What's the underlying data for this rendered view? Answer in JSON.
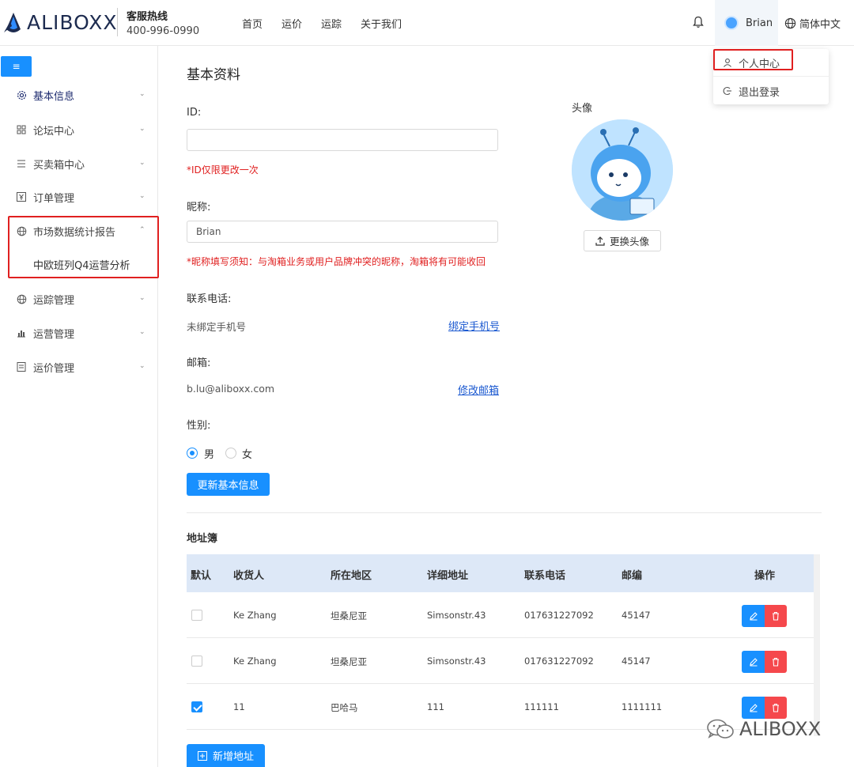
{
  "header": {
    "logo_text": "ALIBOXX",
    "hotline_label": "客服热线",
    "hotline_number": "400-996-0990",
    "nav": [
      "首页",
      "运价",
      "运踪",
      "关于我们"
    ],
    "user_name": "Brian",
    "language": "简体中文"
  },
  "dropdown": {
    "items": [
      "个人中心",
      "退出登录"
    ]
  },
  "sidebar": {
    "collapse_label": "≡",
    "items": [
      {
        "label": "基本信息",
        "icon": "gear-icon"
      },
      {
        "label": "论坛中心",
        "icon": "grid-icon"
      },
      {
        "label": "买卖箱中心",
        "icon": "list-icon"
      },
      {
        "label": "订单管理",
        "icon": "yen-icon"
      },
      {
        "label": "市场数据统计报告",
        "icon": "globe-icon"
      },
      {
        "label": "运踪管理",
        "icon": "globe-icon"
      },
      {
        "label": "运营管理",
        "icon": "chart-icon"
      },
      {
        "label": "运价管理",
        "icon": "doc-icon"
      }
    ],
    "sub_item": "中欧班列Q4运营分析"
  },
  "main": {
    "title": "基本资料",
    "id_label": "ID:",
    "id_value": "",
    "id_hint": "*ID仅限更改一次",
    "nickname_label": "昵称:",
    "nickname_value": "Brian",
    "nickname_hint": "*昵称填写须知：与淘箱业务或用户品牌冲突的昵称，淘箱将有可能收回",
    "phone_label": "联系电话:",
    "phone_value": "未绑定手机号",
    "phone_link": "绑定手机号",
    "email_label": "邮箱:",
    "email_value": "b.lu@aliboxx.com",
    "email_link": "修改邮箱",
    "gender_label": "性别:",
    "gender_male": "男",
    "gender_female": "女",
    "update_button": "更新基本信息",
    "avatar_label": "头像",
    "change_avatar": "更换头像"
  },
  "address_book": {
    "title": "地址簿",
    "columns": [
      "默认",
      "收货人",
      "所在地区",
      "详细地址",
      "联系电话",
      "邮编",
      "操作"
    ],
    "rows": [
      {
        "default": false,
        "receiver": "Ke Zhang",
        "region": "坦桑尼亚",
        "address": "Simsonstr.43",
        "phone": "017631227092",
        "zip": "45147"
      },
      {
        "default": false,
        "receiver": "Ke Zhang",
        "region": "坦桑尼亚",
        "address": "Simsonstr.43",
        "phone": "017631227092",
        "zip": "45147"
      },
      {
        "default": true,
        "receiver": "11",
        "region": "巴哈马",
        "address": "111",
        "phone": "111111",
        "zip": "1111111"
      }
    ],
    "add_button": "新增地址"
  },
  "watermark": "ALIBOXX",
  "colors": {
    "primary": "#1890ff",
    "danger": "#f5484c",
    "hint_red": "#e02020",
    "link": "#1a58d0",
    "table_header": "#dde8f7"
  }
}
